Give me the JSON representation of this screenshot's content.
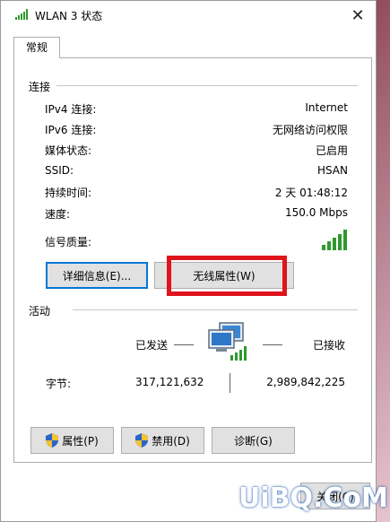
{
  "window": {
    "title": "WLAN 3 状态",
    "close_glyph": "✕"
  },
  "tab": {
    "label": "常规"
  },
  "connection": {
    "section_label": "连接",
    "rows": [
      {
        "label": "IPv4 连接:",
        "value": "Internet"
      },
      {
        "label": "IPv6 连接:",
        "value": "无网络访问权限"
      },
      {
        "label": "媒体状态:",
        "value": "已启用"
      },
      {
        "label": "SSID:",
        "value": "HSAN"
      },
      {
        "label": "持续时间:",
        "value": "2 天 01:48:12"
      },
      {
        "label": "速度:",
        "value": "150.0 Mbps"
      }
    ],
    "signal_label": "信号质量:",
    "signal_bars": 5,
    "details_button": "详细信息(E)...",
    "wireless_props_button": "无线属性(W)"
  },
  "activity": {
    "section_label": "活动",
    "sent_label": "已发送",
    "received_label": "已接收",
    "bytes_label": "字节:",
    "bytes_sent": "317,121,632",
    "bytes_received": "2,989,842,225"
  },
  "actions": {
    "properties": "属性(P)",
    "disable": "禁用(D)",
    "diagnose": "诊断(G)"
  },
  "footer": {
    "close_button": "关闭(C)"
  },
  "watermark": "UiBQ.CoM",
  "colors": {
    "highlight": "#e0141c",
    "signal": "#2e9a2e",
    "focus": "#0078d7"
  },
  "icons": [
    "wifi-signal-icon",
    "close-icon",
    "network-computers-icon",
    "shield-icon"
  ]
}
